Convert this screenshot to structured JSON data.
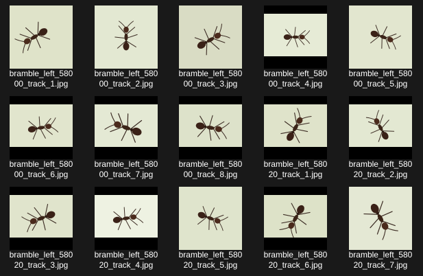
{
  "files": [
    {
      "name_line1": "bramble_left_580",
      "name_line2": "00_track_1.jpg",
      "bg": "#dfe3c9",
      "frame": "full",
      "ant_rotation": -30,
      "ant_dx": -10,
      "ant_dy": 0,
      "ant_scale": 1.0
    },
    {
      "name_line1": "bramble_left_580",
      "name_line2": "00_track_2.jpg",
      "bg": "#e3e8d2",
      "frame": "full",
      "ant_rotation": 90,
      "ant_dx": 0,
      "ant_dy": 0,
      "ant_scale": 0.9
    },
    {
      "name_line1": "bramble_left_580",
      "name_line2": "00_track_3.jpg",
      "bg": "#d9dcc4",
      "frame": "full",
      "ant_rotation": 150,
      "ant_dx": 0,
      "ant_dy": 4,
      "ant_scale": 1.0
    },
    {
      "name_line1": "bramble_left_580",
      "name_line2": "00_track_4.jpg",
      "bg": "#e6ebd6",
      "frame": "letterbox",
      "ant_rotation": 180,
      "ant_dx": 0,
      "ant_dy": 0,
      "ant_scale": 0.8
    },
    {
      "name_line1": "bramble_left_580",
      "name_line2": "00_track_5.jpg",
      "bg": "#e2e6cf",
      "frame": "full",
      "ant_rotation": 200,
      "ant_dx": 4,
      "ant_dy": 0,
      "ant_scale": 0.9
    },
    {
      "name_line1": "bramble_left_580",
      "name_line2": "00_track_6.jpg",
      "bg": "#e1e5cd",
      "frame": "letterbox",
      "ant_rotation": 170,
      "ant_dx": 0,
      "ant_dy": 0,
      "ant_scale": 0.9
    },
    {
      "name_line1": "bramble_left_580",
      "name_line2": "00_track_7.jpg",
      "bg": "#e4e9d4",
      "frame": "letterbox",
      "ant_rotation": 20,
      "ant_dx": 0,
      "ant_dy": 0,
      "ant_scale": 1.1
    },
    {
      "name_line1": "bramble_left_580",
      "name_line2": "00_track_8.jpg",
      "bg": "#dde2ca",
      "frame": "letterbox",
      "ant_rotation": 190,
      "ant_dx": 0,
      "ant_dy": 0,
      "ant_scale": 1.0
    },
    {
      "name_line1": "bramble_left_580",
      "name_line2": "20_track_1.jpg",
      "bg": "#dfe3ca",
      "frame": "letterbox",
      "ant_rotation": 120,
      "ant_dx": 0,
      "ant_dy": 0,
      "ant_scale": 1.0
    },
    {
      "name_line1": "bramble_left_580",
      "name_line2": "20_track_2.jpg",
      "bg": "#e3e8d2",
      "frame": "letterbox",
      "ant_rotation": 60,
      "ant_dx": 0,
      "ant_dy": 0,
      "ant_scale": 0.9
    },
    {
      "name_line1": "bramble_left_580",
      "name_line2": "20_track_3.jpg",
      "bg": "#e0e4cc",
      "frame": "letterbox",
      "ant_rotation": -20,
      "ant_dx": 0,
      "ant_dy": 0,
      "ant_scale": 1.0
    },
    {
      "name_line1": "bramble_left_580",
      "name_line2": "20_track_4.jpg",
      "bg": "#eef2e2",
      "frame": "letterbox",
      "ant_rotation": 170,
      "ant_dx": 0,
      "ant_dy": 0,
      "ant_scale": 0.9
    },
    {
      "name_line1": "bramble_left_580",
      "name_line2": "20_track_5.jpg",
      "bg": "#dfe4cc",
      "frame": "full",
      "ant_rotation": 200,
      "ant_dx": 0,
      "ant_dy": 0,
      "ant_scale": 0.9
    },
    {
      "name_line1": "bramble_left_580",
      "name_line2": "20_track_6.jpg",
      "bg": "#dde2c8",
      "frame": "letterbox",
      "ant_rotation": -60,
      "ant_dx": 0,
      "ant_dy": 0,
      "ant_scale": 1.0
    },
    {
      "name_line1": "bramble_left_580",
      "name_line2": "20_track_7.jpg",
      "bg": "#e4e8d4",
      "frame": "full",
      "ant_rotation": 240,
      "ant_dx": 0,
      "ant_dy": 0,
      "ant_scale": 1.1
    }
  ]
}
